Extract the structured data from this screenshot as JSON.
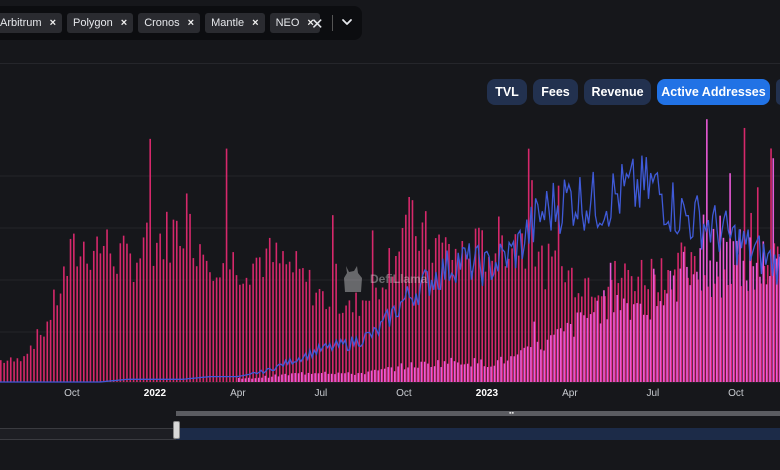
{
  "chain_filter": {
    "tags": [
      {
        "label": "Arbitrum",
        "remove_icon": "close-icon"
      },
      {
        "label": "Polygon",
        "remove_icon": "close-icon"
      },
      {
        "label": "Cronos",
        "remove_icon": "close-icon"
      },
      {
        "label": "Mantle",
        "remove_icon": "close-icon"
      },
      {
        "label": "NEO",
        "remove_icon": "close-icon"
      }
    ],
    "remove_glyph": "×",
    "clear_glyph": "✕"
  },
  "metrics": {
    "tvl": "TVL",
    "fees": "Fees",
    "revenue": "Revenue",
    "active_addresses": "Active Addresses",
    "active": "Active Addresses"
  },
  "watermark": {
    "text": "DefiLlama"
  },
  "colors": {
    "background": "#16171b",
    "series_pink": "#d6286b",
    "series_magenta": "#e85ad6",
    "series_blue": "#3f5ad8",
    "button_bg": "#22314f",
    "button_active": "#2172e5"
  },
  "chart_data": {
    "type": "bar",
    "title": "",
    "xlabel": "",
    "ylabel": "",
    "x_tick_labels": [
      "Oct",
      "2022",
      "Apr",
      "Jul",
      "Oct",
      "2023",
      "Apr",
      "Jul",
      "Oct"
    ],
    "bold_ticks": [
      "2022",
      "2023"
    ],
    "x_start": "2021-08",
    "x_end": "2023-12",
    "series": [
      {
        "color": "#d6286b",
        "kind": "bar",
        "period": "monthly",
        "x": [
          "2021-08",
          "2021-09",
          "2021-10",
          "2021-11",
          "2021-12",
          "2022-01",
          "2022-02",
          "2022-03",
          "2022-04",
          "2022-05",
          "2022-06",
          "2022-07",
          "2022-08",
          "2022-09",
          "2022-10",
          "2022-11",
          "2022-12",
          "2023-01",
          "2023-02",
          "2023-03",
          "2023-04",
          "2023-05",
          "2023-06",
          "2023-07",
          "2023-08",
          "2023-09",
          "2023-10",
          "2023-11",
          "2023-12"
        ],
        "values": [
          8,
          20,
          48,
          52,
          45,
          53,
          58,
          48,
          44,
          47,
          42,
          32,
          27,
          35,
          60,
          52,
          48,
          50,
          55,
          44,
          40,
          38,
          40,
          42,
          44,
          38,
          42,
          44,
          44
        ]
      },
      {
        "color": "#e85ad6",
        "kind": "bar",
        "period": "monthly",
        "x": [
          "2022-04",
          "2022-05",
          "2022-06",
          "2022-07",
          "2022-08",
          "2022-09",
          "2022-10",
          "2022-11",
          "2022-12",
          "2023-01",
          "2023-02",
          "2023-03",
          "2023-04",
          "2023-05",
          "2023-06",
          "2023-07",
          "2023-08",
          "2023-09",
          "2023-10",
          "2023-11",
          "2023-12"
        ],
        "values": [
          1,
          2,
          3,
          4,
          3,
          4,
          6,
          7,
          8,
          7,
          9,
          14,
          20,
          28,
          30,
          28,
          40,
          55,
          48,
          45,
          35
        ]
      },
      {
        "color": "#3f5ad8",
        "kind": "line",
        "period": "monthly",
        "x": [
          "2021-08",
          "2021-09",
          "2021-10",
          "2021-11",
          "2021-12",
          "2022-01",
          "2022-02",
          "2022-03",
          "2022-04",
          "2022-05",
          "2022-06",
          "2022-07",
          "2022-08",
          "2022-09",
          "2022-10",
          "2022-11",
          "2022-12",
          "2023-01",
          "2023-02",
          "2023-03",
          "2023-04",
          "2023-05",
          "2023-06",
          "2023-07",
          "2023-08",
          "2023-09",
          "2023-10",
          "2023-11",
          "2023-12"
        ],
        "values": [
          0,
          0,
          0,
          0,
          1,
          1,
          1,
          2,
          2,
          4,
          8,
          12,
          14,
          18,
          30,
          38,
          45,
          42,
          48,
          62,
          68,
          66,
          70,
          72,
          62,
          58,
          52,
          46,
          40
        ]
      }
    ]
  }
}
